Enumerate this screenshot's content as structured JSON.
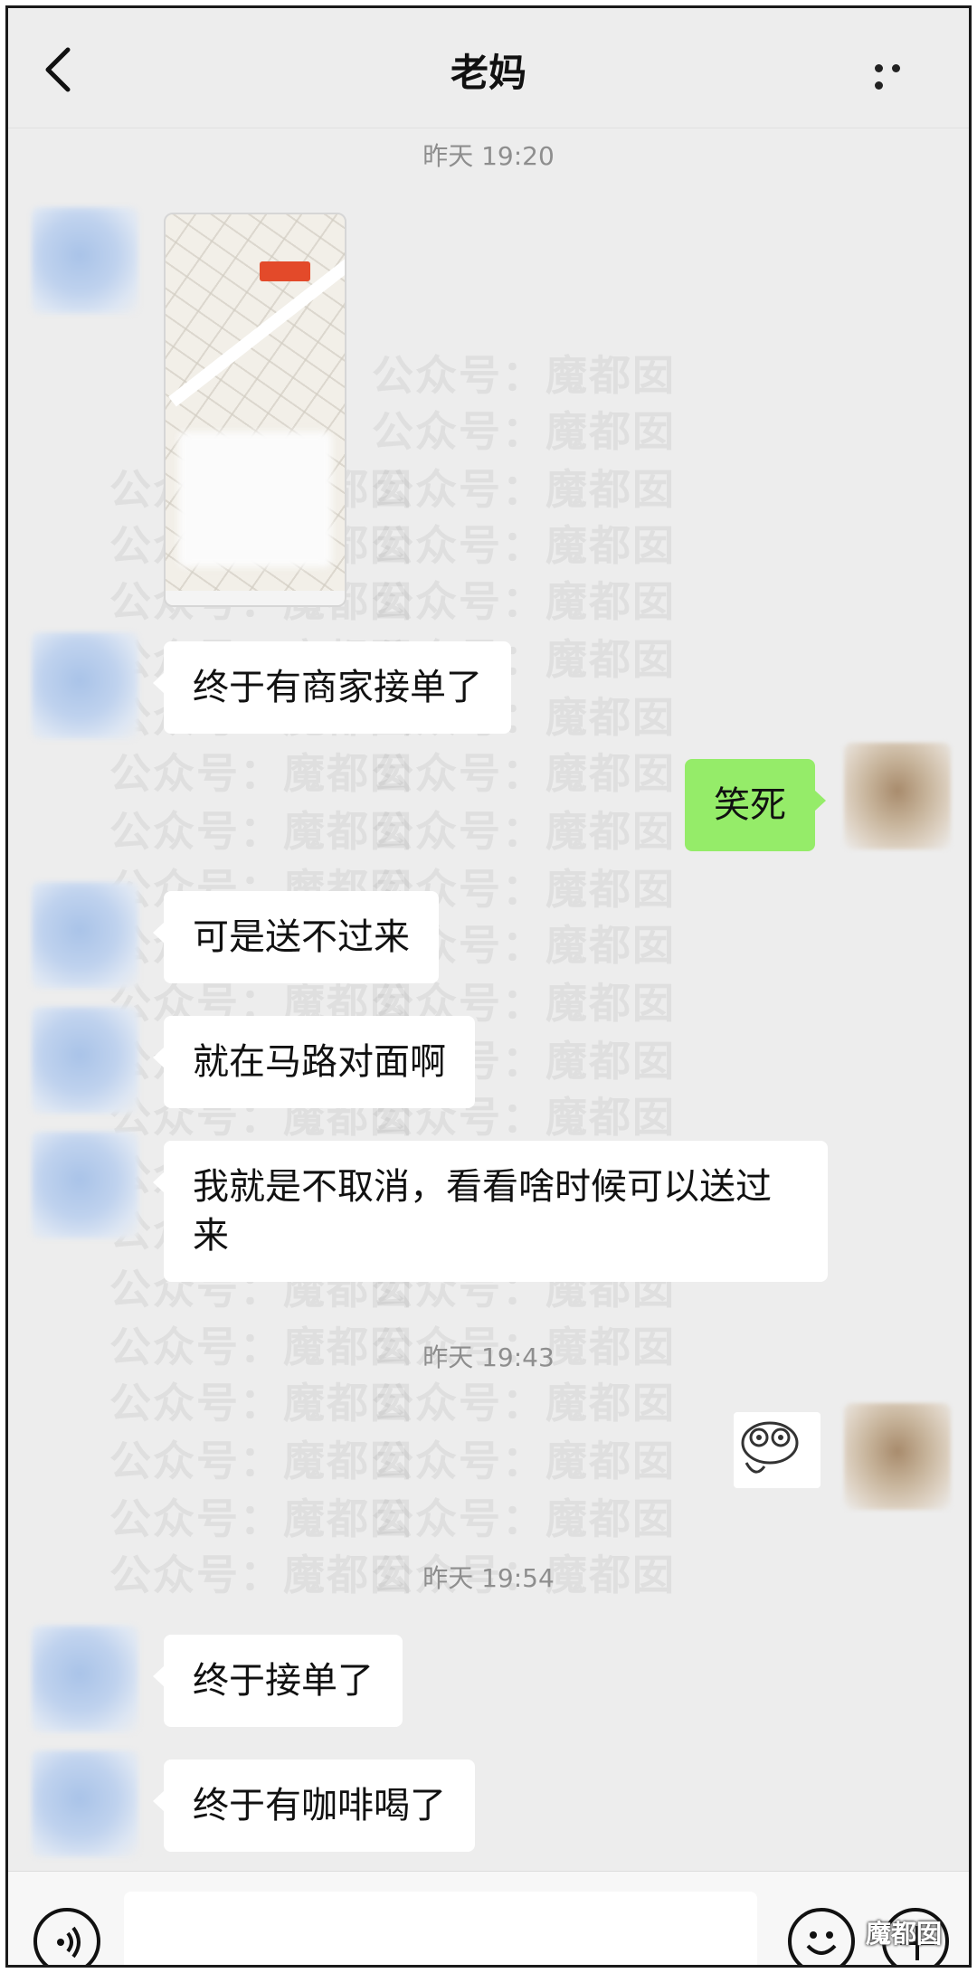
{
  "header": {
    "title": "老妈"
  },
  "timestamps": [
    "昨天 19:20",
    "昨天 19:43",
    "昨天 19:54"
  ],
  "messages": {
    "m1": "终于有商家接单了",
    "m2": "笑死",
    "m3": "可是送不过来",
    "m4": "就在马路对面啊",
    "m5": "我就是不取消，看看啥时候可以送过来",
    "m6": "终于接单了",
    "m7": "终于有咖啡喝了"
  },
  "watermark_text": "公众号：魔都囡",
  "corner_mark": "魔都囡",
  "icons": {
    "back": "chevron-left-icon",
    "more": "more-dots-icon",
    "voice": "voice-icon",
    "emoji": "emoji-icon",
    "plus": "plus-icon"
  },
  "colors": {
    "sent_bubble": "#95ec69",
    "received_bubble": "#ffffff",
    "background": "#ededed"
  }
}
